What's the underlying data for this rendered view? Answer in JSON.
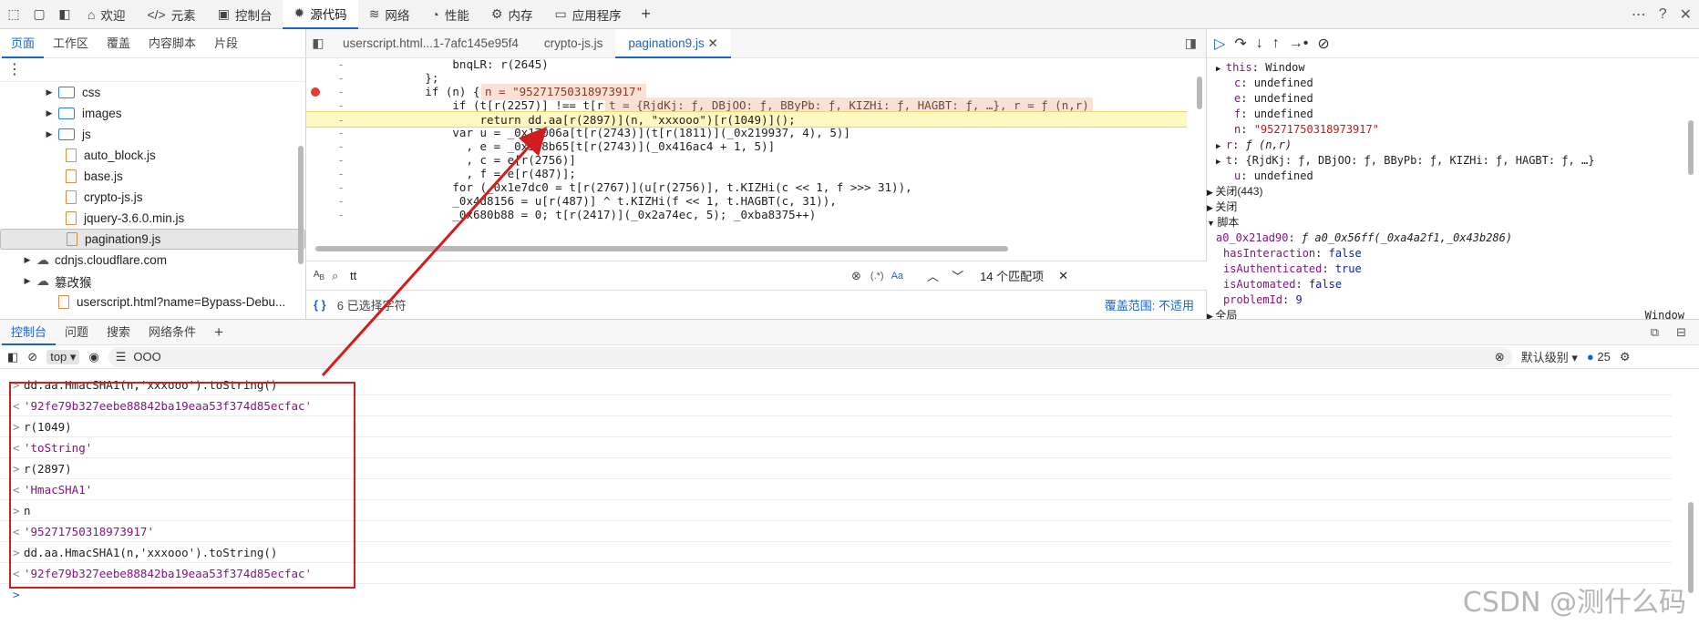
{
  "topbar": {
    "tabs": [
      {
        "icon": "home-icon",
        "label": "欢迎"
      },
      {
        "icon": "code-icon",
        "label": "元素"
      },
      {
        "icon": "console-icon",
        "label": "控制台"
      },
      {
        "icon": "bug-icon",
        "label": "源代码"
      },
      {
        "icon": "wifi-icon",
        "label": "网络"
      },
      {
        "icon": "gauge-icon",
        "label": "性能"
      },
      {
        "icon": "memory-icon",
        "label": "内存"
      },
      {
        "icon": "app-icon",
        "label": "应用程序"
      }
    ],
    "active_tab": "源代码"
  },
  "sources": {
    "subtabs": [
      "页面",
      "工作区",
      "覆盖",
      "内容脚本",
      "片段"
    ],
    "tree": [
      {
        "type": "folder",
        "label": "css"
      },
      {
        "type": "folder",
        "label": "images"
      },
      {
        "type": "folder",
        "label": "js"
      },
      {
        "type": "file",
        "label": "auto_block.js"
      },
      {
        "type": "file",
        "label": "base.js"
      },
      {
        "type": "file",
        "label": "crypto-js.js"
      },
      {
        "type": "file",
        "label": "jquery-3.6.0.min.js"
      },
      {
        "type": "file",
        "label": "pagination9.js"
      },
      {
        "type": "cloud",
        "label": "cdnjs.cloudflare.com"
      },
      {
        "type": "cloud",
        "label": "篡改猴"
      },
      {
        "type": "file",
        "label": "userscript.html?name=Bypass-Debu..."
      }
    ]
  },
  "editor": {
    "tabs": [
      "userscript.html...1-7afc145e95f4",
      "crypto-js.js",
      "pagination9.js"
    ],
    "active_tab": "pagination9.js",
    "lines": [
      {
        "text": "                bnqLR: r(2645)",
        "inline": ""
      },
      {
        "text": "            };",
        "inline": ""
      },
      {
        "text": "            if (n) {",
        "inline": "n = \"95271750318973917\""
      },
      {
        "text": "                if (t[r(2257)] !== t[r(697)])",
        "inline": "t = {RjdKj: ƒ, DBjOO: ƒ, BByPb: ƒ, KIZHi: ƒ, HAGBT: ƒ, …}, r = ƒ (n,r)"
      },
      {
        "text": "                    return dd.aa[r(2897)](n, \"xxxooo\")[r(1049)]();",
        "inline": ""
      },
      {
        "text": "                var u = _0x17006a[t[r(2743)](t[r(1811)](_0x219937, 4), 5)]",
        "inline": ""
      },
      {
        "text": "                  , e = _0x388b65[t[r(2743)](_0x416ac4 + 1, 5)]",
        "inline": ""
      },
      {
        "text": "                  , c = e[r(2756)]",
        "inline": ""
      },
      {
        "text": "                  , f = e[r(487)];",
        "inline": ""
      },
      {
        "text": "                for (_0x1e7dc0 = t[r(2767)](u[r(2756)], t.KIZHi(c << 1, f >>> 31)),",
        "inline": ""
      },
      {
        "text": "                _0x4d8156 = u[r(487)] ^ t.KIZHi(f << 1, t.HAGBT(c, 31)),",
        "inline": ""
      },
      {
        "text": "                _0x680b88 = 0; t[r(2417)](_0x2a74ec, 5); _0xba8375++)",
        "inline": ""
      }
    ],
    "search": {
      "value": "tt",
      "option_regex": "(.*)",
      "option_case": "Aa",
      "match_count": "14 个匹配项"
    },
    "status": {
      "left": "{ }",
      "selection": "6 已选择字符",
      "coverage": "覆盖范围: 不适用"
    }
  },
  "debugger": {
    "scope_lines": [
      {
        "indent": 0,
        "arrow": "▶",
        "key": "this",
        "value": "Window",
        "kind": "plain"
      },
      {
        "indent": 1,
        "arrow": "",
        "key": "c",
        "value": "undefined",
        "kind": "plain"
      },
      {
        "indent": 1,
        "arrow": "",
        "key": "e",
        "value": "undefined",
        "kind": "plain"
      },
      {
        "indent": 1,
        "arrow": "",
        "key": "f",
        "value": "undefined",
        "kind": "plain"
      },
      {
        "indent": 1,
        "arrow": "",
        "key": "n",
        "value": "\"95271750318973917\"",
        "kind": "str"
      },
      {
        "indent": 0,
        "arrow": "▶",
        "key": "r",
        "value": "ƒ (n,r)",
        "kind": "fn"
      },
      {
        "indent": 0,
        "arrow": "▶",
        "key": "t",
        "value": "{RjdKj: ƒ, DBjOO: ƒ, BByPb: ƒ, KIZHi: ƒ, HAGBT: ƒ, …}",
        "kind": "plain"
      },
      {
        "indent": 1,
        "arrow": "",
        "key": "u",
        "value": "undefined",
        "kind": "plain"
      }
    ],
    "sections": [
      "关闭(443)",
      "关闭",
      "脚本"
    ],
    "script_lines": [
      {
        "key": "a0_0x21ad90",
        "value": "ƒ a0_0x56ff(_0xa4a2f1,_0x43b286)",
        "kind": "fn"
      },
      {
        "key": "hasInteraction",
        "value": "false",
        "kind": "bool"
      },
      {
        "key": "isAuthenticated",
        "value": "true",
        "kind": "bool"
      },
      {
        "key": "isAutomated",
        "value": "false",
        "kind": "bool"
      },
      {
        "key": "problemId",
        "value": "9",
        "kind": "num"
      }
    ],
    "last_section": "全局",
    "last_value": "Window"
  },
  "drawer": {
    "tabs": [
      "控制台",
      "问题",
      "搜索",
      "网络条件"
    ],
    "active_tab": "控制台",
    "context": "top",
    "filter": "OOO",
    "level": "默认级别",
    "count": "25",
    "lines": [
      {
        "pfx": ">",
        "kind": "cmd",
        "text": "dd.aa.HmacSHA1(n,'xxxooo').toString()"
      },
      {
        "pfx": "<",
        "kind": "res",
        "text": "'92fe79b327eebe88842ba19eaa53f374d85ecfac'"
      },
      {
        "pfx": ">",
        "kind": "cmd",
        "text": "r(1049)"
      },
      {
        "pfx": "<",
        "kind": "res",
        "text": "'toString'"
      },
      {
        "pfx": ">",
        "kind": "cmd",
        "text": "r(2897)"
      },
      {
        "pfx": "<",
        "kind": "res",
        "text": "'HmacSHA1'"
      },
      {
        "pfx": ">",
        "kind": "cmd",
        "text": "n"
      },
      {
        "pfx": "<",
        "kind": "res",
        "text": "'95271750318973917'"
      },
      {
        "pfx": ">",
        "kind": "cmd",
        "text": "dd.aa.HmacSHA1(n,'xxxooo').toString()"
      },
      {
        "pfx": "<",
        "kind": "res",
        "text": "'92fe79b327eebe88842ba19eaa53f374d85ecfac'"
      }
    ]
  },
  "watermark": "CSDN @测什么码",
  "colors": {
    "accent": "#1a64c9",
    "annotation": "#d11d1d",
    "highlight": "#fff7c2"
  }
}
